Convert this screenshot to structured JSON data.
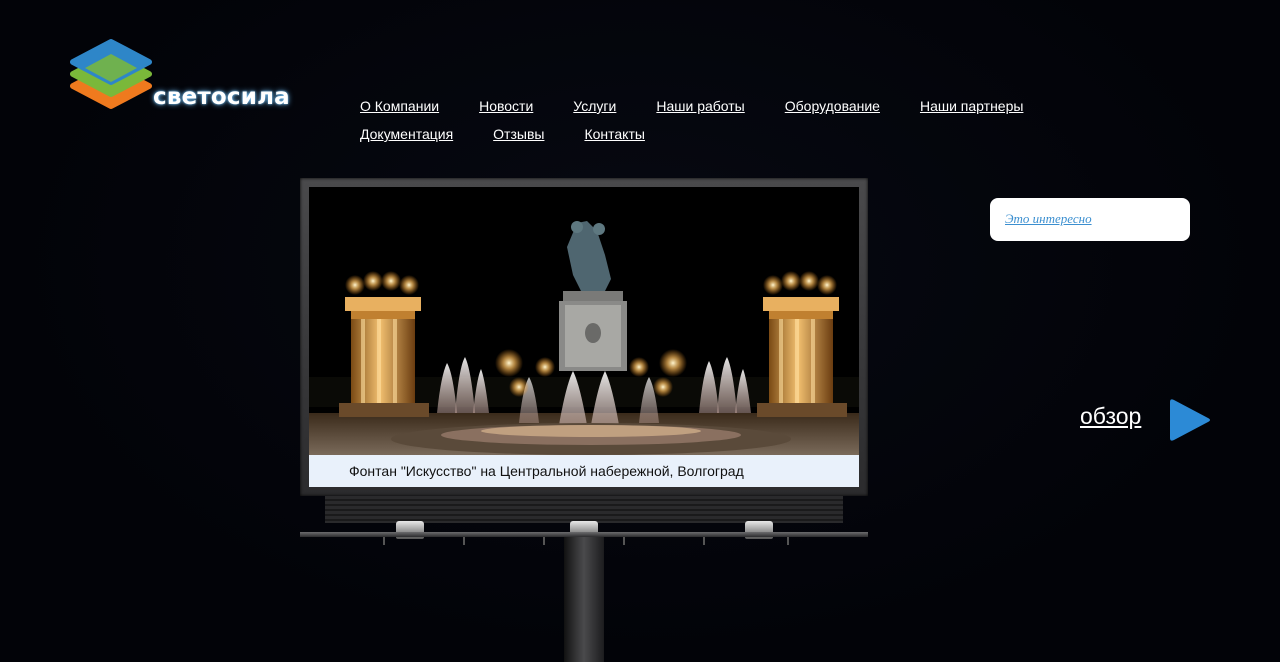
{
  "brand": {
    "name": "светосила",
    "colors": {
      "blue": "#2e86c8",
      "green": "#7ab83a",
      "orange": "#ef7a1e"
    }
  },
  "nav": {
    "row1": [
      {
        "label": "О Компании"
      },
      {
        "label": "Новости"
      },
      {
        "label": "Услуги"
      },
      {
        "label": "Наши работы"
      },
      {
        "label": "Оборудование"
      },
      {
        "label": "Наши партнеры"
      }
    ],
    "row2": [
      {
        "label": "Документация"
      },
      {
        "label": "Отзывы"
      },
      {
        "label": "Контакты"
      }
    ]
  },
  "billboard": {
    "caption": "Фонтан \"Искусство\" на Центральной набережной, Волгоград"
  },
  "sidebar": {
    "link_label": "Это интересно"
  },
  "overview": {
    "label": "обзор",
    "arrow_color": "#2c8ad6"
  }
}
